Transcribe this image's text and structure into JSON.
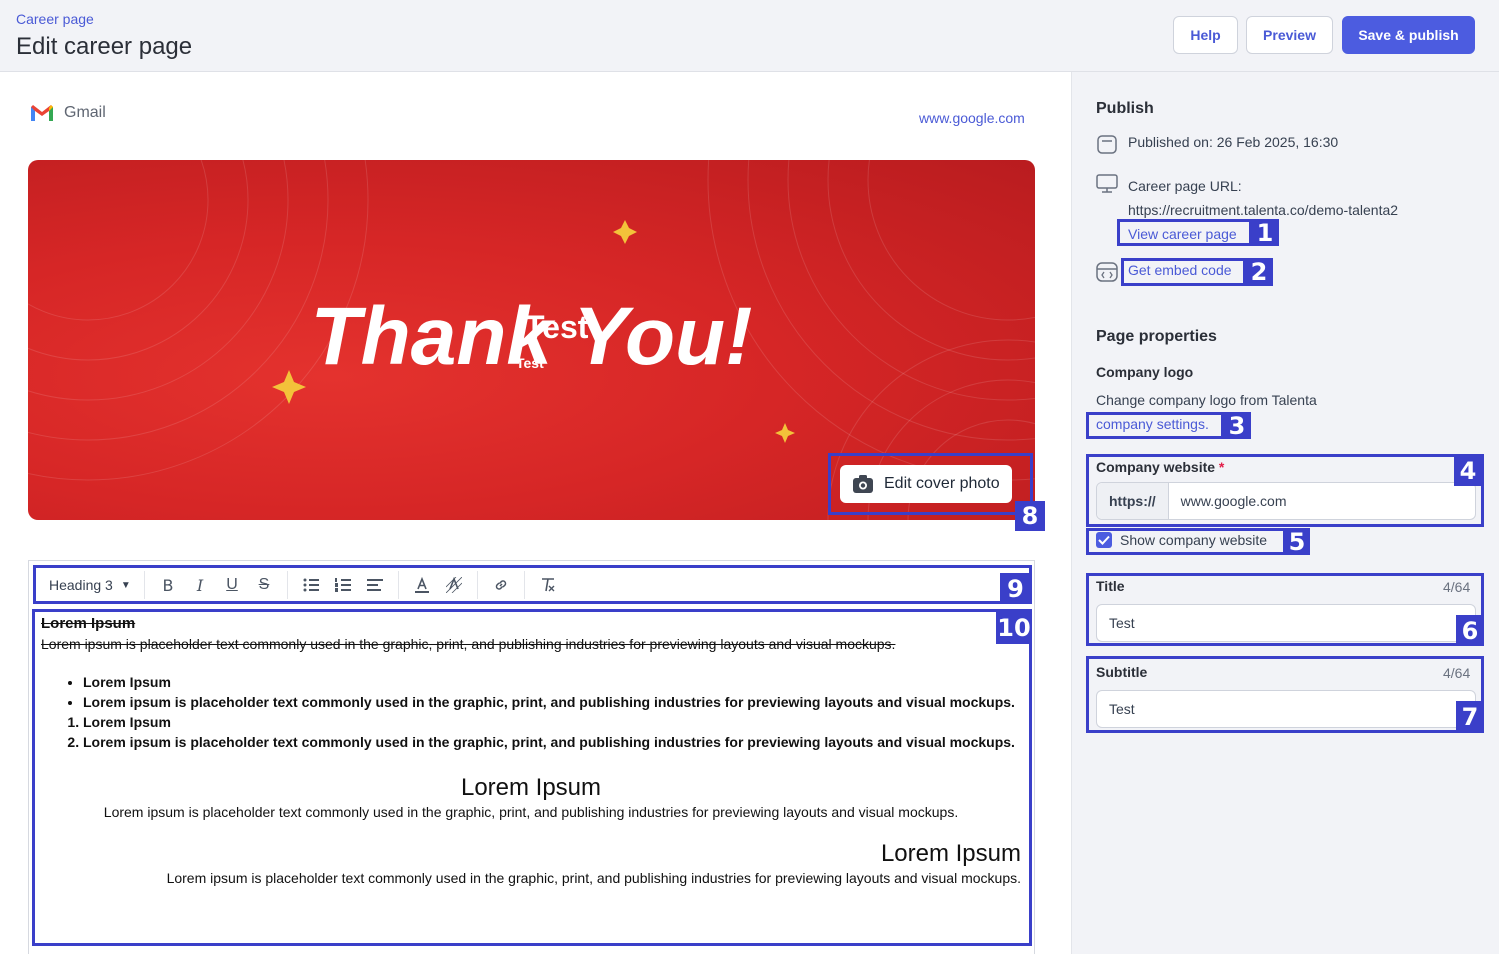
{
  "header": {
    "breadcrumb": "Career page",
    "title": "Edit career page",
    "help": "Help",
    "preview": "Preview",
    "save": "Save & publish"
  },
  "brand": {
    "name": "Gmail",
    "website": "www.google.com"
  },
  "cover": {
    "image_text": "Thank You!",
    "title": "Test",
    "subtitle": "Test",
    "edit_button": "Edit cover photo"
  },
  "toolbar": {
    "style": "Heading 3"
  },
  "editor": {
    "h1": "Lorem Ipsum",
    "p1": "Lorem ipsum is placeholder text commonly used in the graphic, print, and publishing industries for previewing layouts and visual mockups.",
    "bullets": [
      "Lorem Ipsum",
      "Lorem ipsum is placeholder text commonly used in the graphic, print, and publishing industries for previewing layouts and visual mockups."
    ],
    "numbered": [
      "Lorem Ipsum",
      "Lorem ipsum is placeholder text commonly used in the graphic, print, and publishing industries for previewing layouts and visual mockups."
    ],
    "center_heading": "Lorem Ipsum",
    "center_text": "Lorem ipsum is placeholder text commonly used in the graphic, print, and publishing industries for previewing layouts and visual mockups.",
    "right_heading": "Lorem Ipsum",
    "right_text": "Lorem ipsum is placeholder text commonly used in the graphic, print, and publishing industries for previewing layouts and visual mockups."
  },
  "panel": {
    "publish_heading": "Publish",
    "published_on": "Published on: 26 Feb 2025, 16:30",
    "url_label": "Career page URL:",
    "url": "https://recruitment.talenta.co/demo-talenta2",
    "view_link": "View career page",
    "embed_link": "Get embed code",
    "props_heading": "Page properties",
    "logo_label": "Company logo",
    "logo_text": "Change company logo from Talenta",
    "settings_link": "company settings.",
    "website_label": "Company website",
    "required_mark": "*",
    "website_prefix": "https://",
    "website_value": "www.google.com",
    "show_website": "Show company website",
    "title_label": "Title",
    "title_counter": "4/64",
    "title_value": "Test",
    "subtitle_label": "Subtitle",
    "subtitle_counter": "4/64",
    "subtitle_value": "Test"
  },
  "annotations": [
    "1",
    "2",
    "3",
    "4",
    "5",
    "6",
    "7",
    "8",
    "9",
    "10"
  ],
  "colors": {
    "accent": "#4c5ce0",
    "annotation": "#3a3fc9",
    "cover_red": "#d62626"
  }
}
